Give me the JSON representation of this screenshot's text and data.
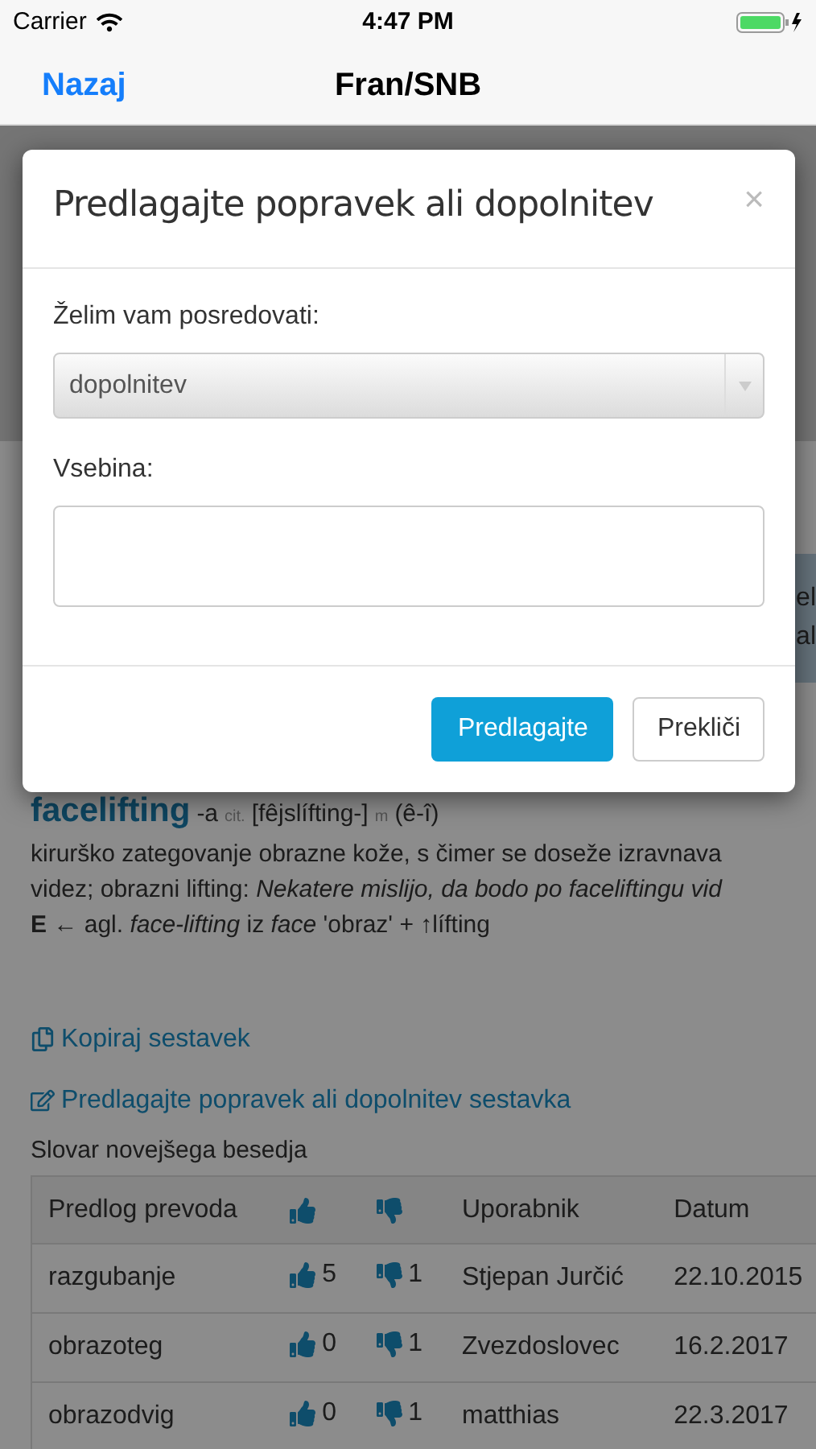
{
  "status_bar": {
    "carrier": "Carrier",
    "time": "4:47 PM"
  },
  "nav": {
    "back": "Nazaj",
    "title": "Fran/SNB"
  },
  "background_panel": {
    "lines": [
      "el",
      "al"
    ]
  },
  "entry": {
    "headword": "facelifting",
    "suffix": "-a",
    "tag1": "cit.",
    "pronunciation": "[fêjslífting-]",
    "tag2": "m",
    "accent": "(ê-î)",
    "lines": [
      "kirurško zategovanje obrazne kože, s čimer se doseže izravnava",
      "videz; obrazni lifting: *Nekatere mislijo, da bodo po faceliftingu vid*",
      "**E** ← agl. *face-lifting* iz *face* 'obraz' + ↑lífting"
    ]
  },
  "links": [
    {
      "kind": "copy",
      "label": "Kopiraj sestavek"
    },
    {
      "kind": "suggest",
      "label": "Predlagajte popravek ali dopolnitev sestavka"
    }
  ],
  "table": {
    "caption": "Slovar novejšega besedja",
    "columns": [
      {
        "kind": "text",
        "label": "Predlog prevoda"
      },
      {
        "kind": "up"
      },
      {
        "kind": "down"
      },
      {
        "kind": "text",
        "label": "Uporabnik"
      },
      {
        "kind": "text",
        "label": "Datum"
      }
    ],
    "rows": [
      {
        "term": "razgubanje",
        "up": "5",
        "down": "1",
        "user": "Stjepan Jurčić",
        "date": "22.10.2015"
      },
      {
        "term": "obrazoteg",
        "up": "0",
        "down": "1",
        "user": "Zvezdoslovec",
        "date": "16.2.2017"
      },
      {
        "term": "obrazodvig",
        "up": "0",
        "down": "1",
        "user": "matthias",
        "date": "22.3.2017"
      }
    ]
  },
  "modal": {
    "title": "Predlagajte popravek ali dopolnitev",
    "close": "×",
    "select_label": "Želim vam posredovati:",
    "select_value": "dopolnitev",
    "content_label": "Vsebina:",
    "submit": "Predlagajte",
    "cancel": "Prekliči"
  }
}
